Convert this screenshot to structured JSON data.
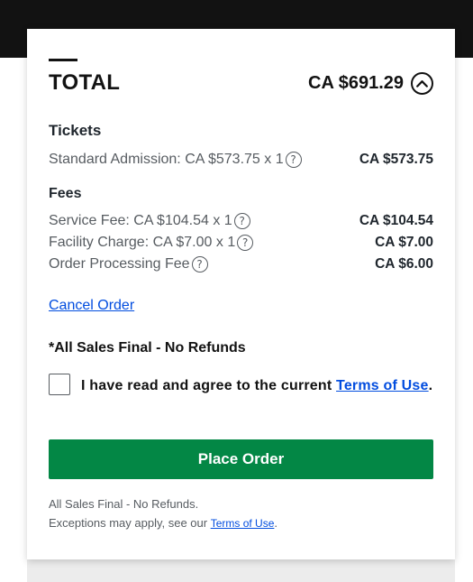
{
  "summary": {
    "total_label": "TOTAL",
    "total_amount": "CA $691.29",
    "collapse_icon": "chevron-up-icon"
  },
  "tickets": {
    "title": "Tickets",
    "items": [
      {
        "label": "Standard Admission: CA $573.75 x 1",
        "amount": "CA $573.75"
      }
    ]
  },
  "fees": {
    "title": "Fees",
    "items": [
      {
        "label": "Service Fee: CA $104.54 x 1",
        "amount": "CA $104.54"
      },
      {
        "label": "Facility Charge: CA $7.00 x 1",
        "amount": "CA $7.00"
      },
      {
        "label": "Order Processing Fee",
        "amount": "CA $6.00"
      }
    ]
  },
  "help_icon_glyph": "?",
  "cancel_link": "Cancel Order",
  "final_notice": "*All Sales Final - No Refunds",
  "agreement": {
    "text": "I have read and agree to the current ",
    "link": "Terms of Use",
    "suffix": "."
  },
  "place_order_label": "Place Order",
  "footer": {
    "line1": "All Sales Final - No Refunds.",
    "line2": "Exceptions may apply, see our ",
    "link": "Terms of Use",
    "suffix": "."
  },
  "colors": {
    "primary_button": "#038745",
    "link": "#024ddf",
    "topbar": "#121212"
  }
}
